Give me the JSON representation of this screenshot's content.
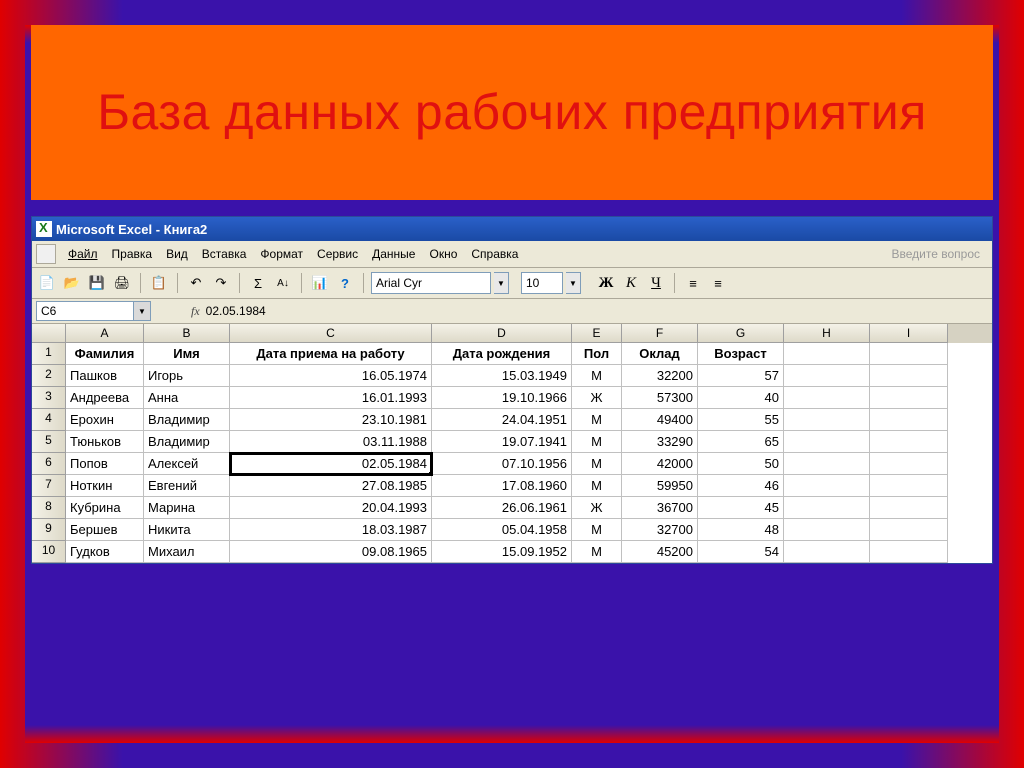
{
  "slide": {
    "title": "База данных рабочих предприятия"
  },
  "window": {
    "title": "Microsoft Excel - Книга2"
  },
  "menu": {
    "file": "Файл",
    "edit": "Правка",
    "view": "Вид",
    "insert": "Вставка",
    "format": "Формат",
    "service": "Сервис",
    "data": "Данные",
    "window": "Окно",
    "help": "Справка",
    "helpPlaceholder": "Введите вопрос"
  },
  "toolbar": {
    "fontName": "Arial Cyr",
    "fontSize": "10",
    "boldLabel": "Ж",
    "italicLabel": "К",
    "underlineLabel": "Ч"
  },
  "formulaBar": {
    "cellRef": "C6",
    "fx": "fx",
    "value": "02.05.1984"
  },
  "columns": [
    "",
    "A",
    "B",
    "C",
    "D",
    "E",
    "F",
    "G",
    "H",
    "I"
  ],
  "headerRow": [
    "1",
    "Фамилия",
    "Имя",
    "Дата приема на работу",
    "Дата рождения",
    "Пол",
    "Оклад",
    "Возраст",
    "",
    ""
  ],
  "rows": [
    [
      "2",
      "Пашков",
      "Игорь",
      "16.05.1974",
      "15.03.1949",
      "М",
      "32200",
      "57",
      "",
      ""
    ],
    [
      "3",
      "Андреева",
      "Анна",
      "16.01.1993",
      "19.10.1966",
      "Ж",
      "57300",
      "40",
      "",
      ""
    ],
    [
      "4",
      "Ерохин",
      "Владимир",
      "23.10.1981",
      "24.04.1951",
      "М",
      "49400",
      "55",
      "",
      ""
    ],
    [
      "5",
      "Тюньков",
      "Владимир",
      "03.11.1988",
      "19.07.1941",
      "М",
      "33290",
      "65",
      "",
      ""
    ],
    [
      "6",
      "Попов",
      "Алексей",
      "02.05.1984",
      "07.10.1956",
      "М",
      "42000",
      "50",
      "",
      ""
    ],
    [
      "7",
      "Ноткин",
      "Евгений",
      "27.08.1985",
      "17.08.1960",
      "М",
      "59950",
      "46",
      "",
      ""
    ],
    [
      "8",
      "Кубрина",
      "Марина",
      "20.04.1993",
      "26.06.1961",
      "Ж",
      "36700",
      "45",
      "",
      ""
    ],
    [
      "9",
      "Бершев",
      "Никита",
      "18.03.1987",
      "05.04.1958",
      "М",
      "32700",
      "48",
      "",
      ""
    ],
    [
      "10",
      "Гудков",
      "Михаил",
      "09.08.1965",
      "15.09.1952",
      "М",
      "45200",
      "54",
      "",
      ""
    ]
  ],
  "activeCell": {
    "row": 6,
    "col": "C"
  },
  "chart_data": {
    "type": "table",
    "title": "База данных рабочих предприятия",
    "columns": [
      "Фамилия",
      "Имя",
      "Дата приема на работу",
      "Дата рождения",
      "Пол",
      "Оклад",
      "Возраст"
    ],
    "rows": [
      [
        "Пашков",
        "Игорь",
        "16.05.1974",
        "15.03.1949",
        "М",
        32200,
        57
      ],
      [
        "Андреева",
        "Анна",
        "16.01.1993",
        "19.10.1966",
        "Ж",
        57300,
        40
      ],
      [
        "Ерохин",
        "Владимир",
        "23.10.1981",
        "24.04.1951",
        "М",
        49400,
        55
      ],
      [
        "Тюньков",
        "Владимир",
        "03.11.1988",
        "19.07.1941",
        "М",
        33290,
        65
      ],
      [
        "Попов",
        "Алексей",
        "02.05.1984",
        "07.10.1956",
        "М",
        42000,
        50
      ],
      [
        "Ноткин",
        "Евгений",
        "27.08.1985",
        "17.08.1960",
        "М",
        59950,
        46
      ],
      [
        "Кубрина",
        "Марина",
        "20.04.1993",
        "26.06.1961",
        "Ж",
        36700,
        45
      ],
      [
        "Бершев",
        "Никита",
        "18.03.1987",
        "05.04.1958",
        "М",
        32700,
        48
      ],
      [
        "Гудков",
        "Михаил",
        "09.08.1965",
        "15.09.1952",
        "М",
        45200,
        54
      ]
    ]
  }
}
